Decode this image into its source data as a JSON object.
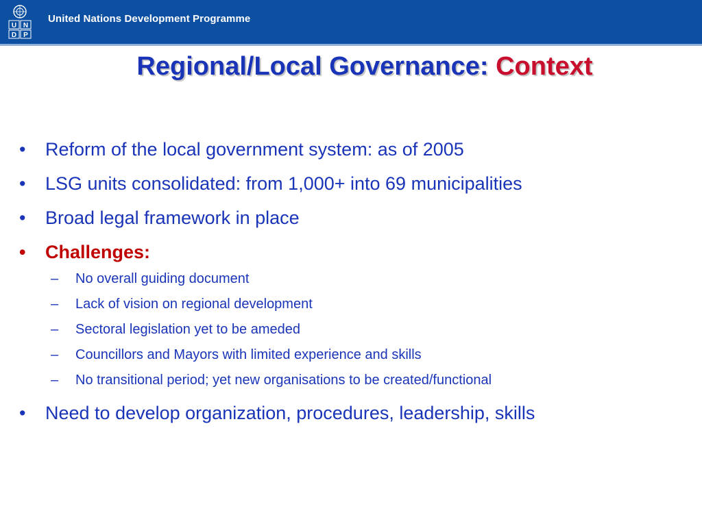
{
  "header": {
    "org_name": "United Nations Development Programme",
    "logo_letters": [
      "U",
      "N",
      "D",
      "P"
    ],
    "bg_color": "#0d4fa0"
  },
  "slide": {
    "title_main": "Regional/Local Governance: ",
    "title_accent": "Context",
    "bullets": [
      "Reform of the local government system: as of 2005",
      "LSG units consolidated: from 1,000+ into 69 municipalities",
      "Broad legal framework in place"
    ],
    "challenges_label": "Challenges:",
    "challenges": [
      "No overall guiding document",
      "Lack of vision on regional development",
      "Sectoral legislation yet to be ameded",
      "Councillors and Mayors with limited experience and skills",
      "No transitional period; yet new organisations to be created/functional"
    ],
    "final_bullet": "Need to develop organization, procedures, leadership, skills"
  },
  "colors": {
    "title_blue": "#1a34b8",
    "accent_red": "#c8102e",
    "challenge_red": "#c00000"
  }
}
